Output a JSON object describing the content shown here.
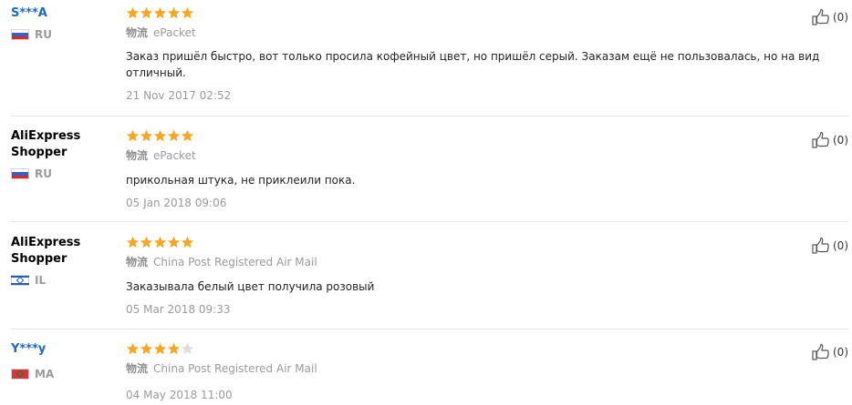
{
  "reviews": [
    {
      "user": "S***A",
      "user_is_link": true,
      "country_code": "RU",
      "country_flag": "ru",
      "rating": 5,
      "shipping_label": "物流",
      "shipping_method": "ePacket",
      "text": "Заказ пришёл быстро, вот только просила кофейный цвет, но пришёл серый. Заказам ещё не пользовалась, но на вид отличный.",
      "date": "21 Nov 2017 02:52",
      "helpful_count": "(0)"
    },
    {
      "user": "AliExpress Shopper",
      "user_is_link": false,
      "country_code": "RU",
      "country_flag": "ru",
      "rating": 5,
      "shipping_label": "物流",
      "shipping_method": "ePacket",
      "text": "прикольная штука, не приклеили пока.",
      "date": "05 Jan 2018 09:06",
      "helpful_count": "(0)"
    },
    {
      "user": "AliExpress Shopper",
      "user_is_link": false,
      "country_code": "IL",
      "country_flag": "il",
      "rating": 5,
      "shipping_label": "物流",
      "shipping_method": "China Post Registered Air Mail",
      "text": "Заказывала белый цвет получила розовый",
      "date": "05 Mar 2018 09:33",
      "helpful_count": "(0)"
    },
    {
      "user": "Y***y",
      "user_is_link": true,
      "country_code": "MA",
      "country_flag": "ma",
      "rating": 4,
      "shipping_label": "物流",
      "shipping_method": "China Post Registered Air Mail",
      "text": "",
      "date": "04 May 2018 11:00",
      "helpful_count": "(0)"
    }
  ],
  "colors": {
    "star_filled": "#f5a623",
    "star_empty": "#dddddd",
    "link_user": "#1c6bc4"
  }
}
